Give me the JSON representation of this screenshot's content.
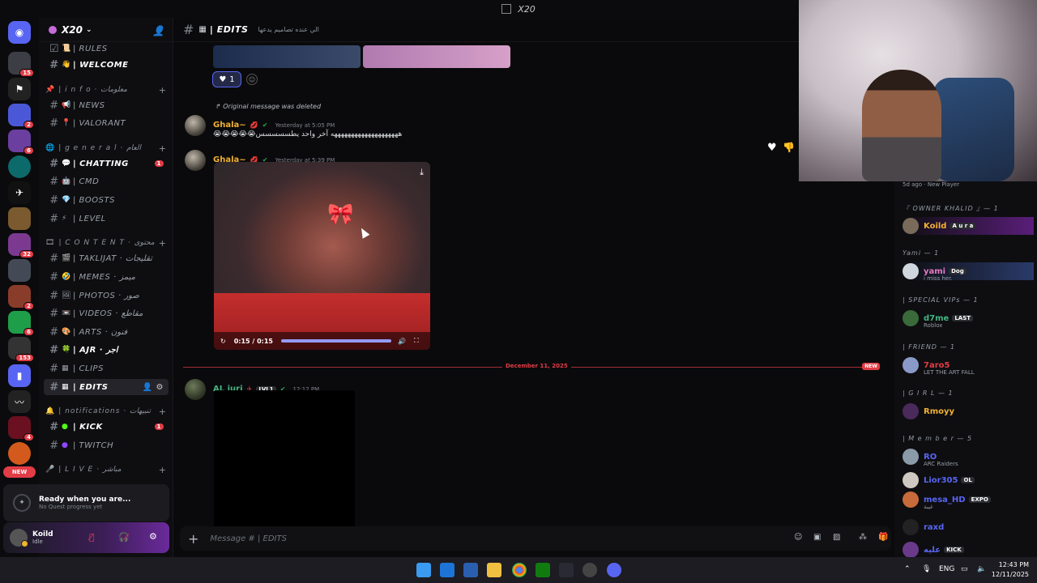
{
  "titlebar": {
    "title": "X20"
  },
  "server": {
    "name": "X20"
  },
  "guild_badges": [
    "15",
    "2",
    "6",
    "32",
    "2",
    "6",
    "153",
    "4"
  ],
  "new_pill": "NEW",
  "channels": {
    "rules": "| RULES",
    "welcome": "| WELCOME",
    "cat_info": "| i n f o · معلومات",
    "news": "| NEWS",
    "valorant": "| VALORANT",
    "cat_general": "| g e n e r a l · العام",
    "chatting": "| CHATTING",
    "chatting_count": "1",
    "cmd": "| CMD",
    "boosts": "| BOOSTS",
    "level": "| LEVEL",
    "cat_content": "| C O N T E N T · محتوى",
    "taklijat": "| TAKLIJAT · تقليجات",
    "memes": "| MEMES · ميمز",
    "photos": "| PHOTOS · صور",
    "videos": "| VIDEOS · مقاطع",
    "arts": "| ARTS · فنون",
    "ajr": "| AJR · اجر",
    "clips": "| CLIPS",
    "edits": "| EDITS",
    "cat_notifications": "| notifications · تنبيهات",
    "kick": "| KICK",
    "kick_count": "1",
    "twitch": "| TWITCH",
    "cat_live": "| L I V E · مباشر"
  },
  "quest": {
    "title": "Ready when you are...",
    "subtitle": "No Quest progress yet"
  },
  "user": {
    "name": "Koild",
    "status": "Idle"
  },
  "header": {
    "channel": "| EDITS",
    "topic": "الي عنده تصاميم يدعها"
  },
  "messages": {
    "reaction_count": "1",
    "deleted_note": "Original message was deleted",
    "m1_author": "Ghala~",
    "m1_time": "Yesterday at 5:05 PM",
    "m1_text": "😭😭😭😭😭ههههههههههههههههههههه آخر واحد يطسسسسس",
    "m2_author": "Ghala~",
    "m2_time": "Yesterday at 5:39 PM",
    "video_time": "0:15 / 0:15",
    "date_divider": "December 11, 2025",
    "new_tag": "NEW",
    "m3_author": "AL juri",
    "m3_level": "LVL1",
    "m3_time": "12:12 PM"
  },
  "composer": {
    "placeholder": "Message # | EDITS"
  },
  "webcam_overlay": {
    "time_ago": "5d ago",
    "label": "New Player"
  },
  "members": {
    "cat_owner": "『 OWNER KHALID 』— 1",
    "owner_name": "Koild",
    "owner_tag": "A u r a",
    "cat_yami": "Yami — 1",
    "yami_name": "yami",
    "yami_tag": "Dog",
    "yami_sub": "i miss her.",
    "cat_special": "| SPECIAL VIPs — 1",
    "d7me_name": "d7me",
    "d7me_tag": "LAST",
    "d7me_sub": "Roblox",
    "cat_friend": "| FRIEND — 1",
    "friend_name": "7aro5",
    "friend_sub": "LET THE ART FALL",
    "cat_girl": "| G I R L — 1",
    "girl_name": "Rmoyy",
    "cat_member": "| M e m b e r — 5",
    "m1": "RO",
    "m1_sub": "ARC Raiders",
    "m2": "Lior305",
    "m2_tag": "OL",
    "m3": "mesa_HD",
    "m3_tag": "EXPO",
    "m3_sub": "غيبة",
    "m4": "raxd",
    "m5": "عليه",
    "m5_tag": "KICK"
  },
  "taskbar": {
    "lang": "ENG",
    "time": "12:43 PM",
    "date": "12/11/2025"
  },
  "colors": {
    "accent": "#5865f2",
    "danger": "#e23c46",
    "green_role": "#43b581",
    "gold_role": "#f0b232"
  }
}
